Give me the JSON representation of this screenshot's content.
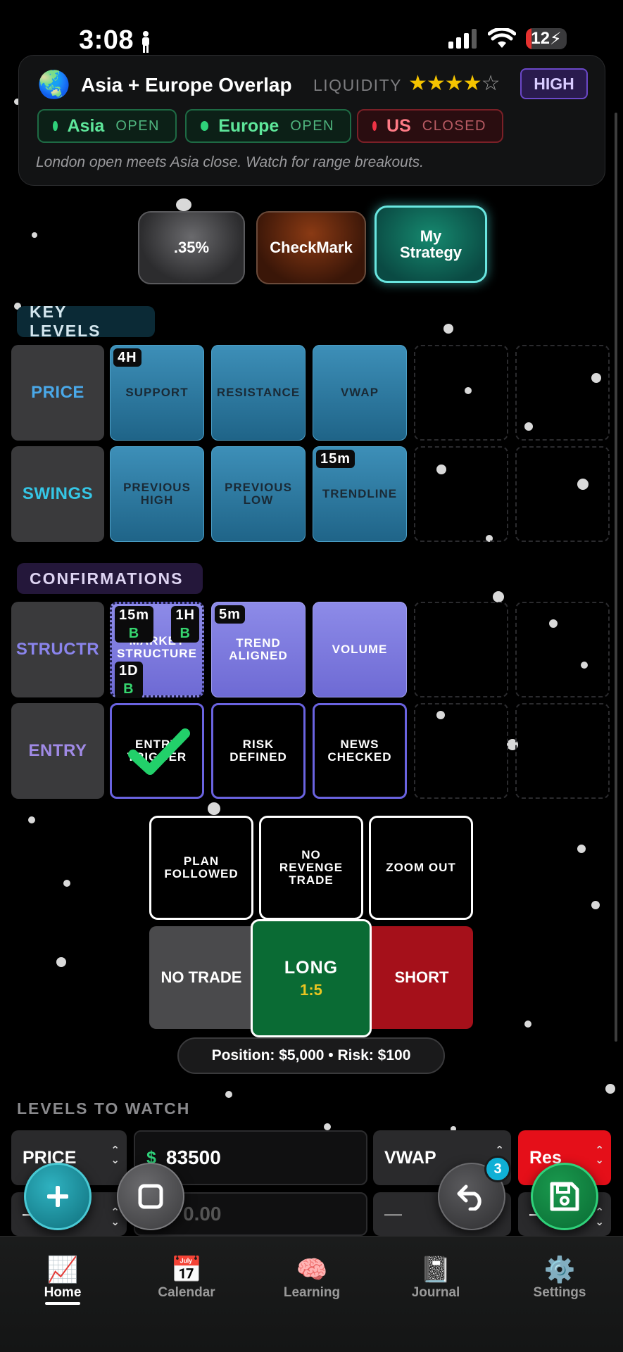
{
  "status_bar": {
    "time": "3:08",
    "battery": "12"
  },
  "session": {
    "title": "Asia + Europe Overlap",
    "liquidity_label": "LIQUIDITY",
    "stars_filled": "★★★★",
    "stars_empty": "☆",
    "rating": 4,
    "rating_max": 5,
    "level_badge": "HIGH",
    "markets": [
      {
        "name": "Asia",
        "state": "OPEN"
      },
      {
        "name": "Europe",
        "state": "OPEN"
      },
      {
        "name": "US",
        "state": "CLOSED"
      }
    ],
    "note": "London open meets Asia close. Watch for range breakouts."
  },
  "strategies": [
    {
      "label": ".35%"
    },
    {
      "label": "CheckMark"
    },
    {
      "label_line1": "My",
      "label_line2": "Strategy",
      "active": true
    }
  ],
  "key_levels": {
    "title": "KEY LEVELS",
    "rows": [
      {
        "label": "PRICE",
        "tiles": [
          {
            "label": "SUPPORT",
            "timeframe": "4H"
          },
          {
            "label": "RESISTANCE"
          },
          {
            "label": "VWAP"
          }
        ]
      },
      {
        "label": "SWINGS",
        "tiles": [
          {
            "line1": "PREVIOUS",
            "line2": "HIGH"
          },
          {
            "line1": "PREVIOUS",
            "line2": "LOW"
          },
          {
            "label": "TRENDLINE",
            "timeframe": "15m"
          }
        ]
      }
    ]
  },
  "confirmations": {
    "title": "CONFIRMATIONS",
    "rows": [
      {
        "label": "STRUCTR",
        "tiles": [
          {
            "line1": "MARKET",
            "line2": "STRUCTURE",
            "tf_a": "15m",
            "tf_a_b": "B",
            "tf_b": "1H",
            "tf_b_b": "B",
            "tf_c": "1D",
            "tf_c_b": "B"
          },
          {
            "line1": "TREND",
            "line2": "ALIGNED",
            "timeframe": "5m"
          },
          {
            "label": "VOLUME"
          }
        ]
      },
      {
        "label": "ENTRY",
        "tiles": [
          {
            "line1": "ENTRY",
            "line2": "TRIGGER",
            "checked": true
          },
          {
            "line1": "RISK",
            "line2": "DEFINED"
          },
          {
            "line1": "NEWS",
            "line2": "CHECKED"
          }
        ]
      }
    ]
  },
  "habits": [
    {
      "line1": "PLAN",
      "line2": "FOLLOWED"
    },
    {
      "line1": "NO",
      "line2": "REVENGE",
      "line3": "TRADE"
    },
    {
      "label": "ZOOM OUT"
    }
  ],
  "decision": {
    "no_trade": "NO TRADE",
    "long": "LONG",
    "long_ratio": "1:5",
    "short": "SHORT"
  },
  "position_summary": "Position: $5,000 • Risk: $100",
  "levels_to_watch": {
    "title": "LEVELS TO WATCH",
    "row1": {
      "type": "PRICE",
      "currency": "$",
      "value": "83500",
      "ref": "VWAP",
      "action": "Res"
    },
    "row2": {
      "type": "—",
      "placeholder": "0.00",
      "ref": "—",
      "action": "—"
    }
  },
  "undo_badge": "3",
  "tabs": [
    {
      "label": "Home",
      "icon": "📈"
    },
    {
      "label": "Calendar",
      "icon": "📅"
    },
    {
      "label": "Learning",
      "icon": "🧠"
    },
    {
      "label": "Journal",
      "icon": "📓"
    },
    {
      "label": "Settings",
      "icon": "⚙️"
    }
  ],
  "colors": {
    "accent_teal": "#0f6f63",
    "long_green": "#0a6b34",
    "short_red": "#a5101a",
    "key_level_blue": "#2a789f",
    "confirm_purple": "#7c79de"
  }
}
